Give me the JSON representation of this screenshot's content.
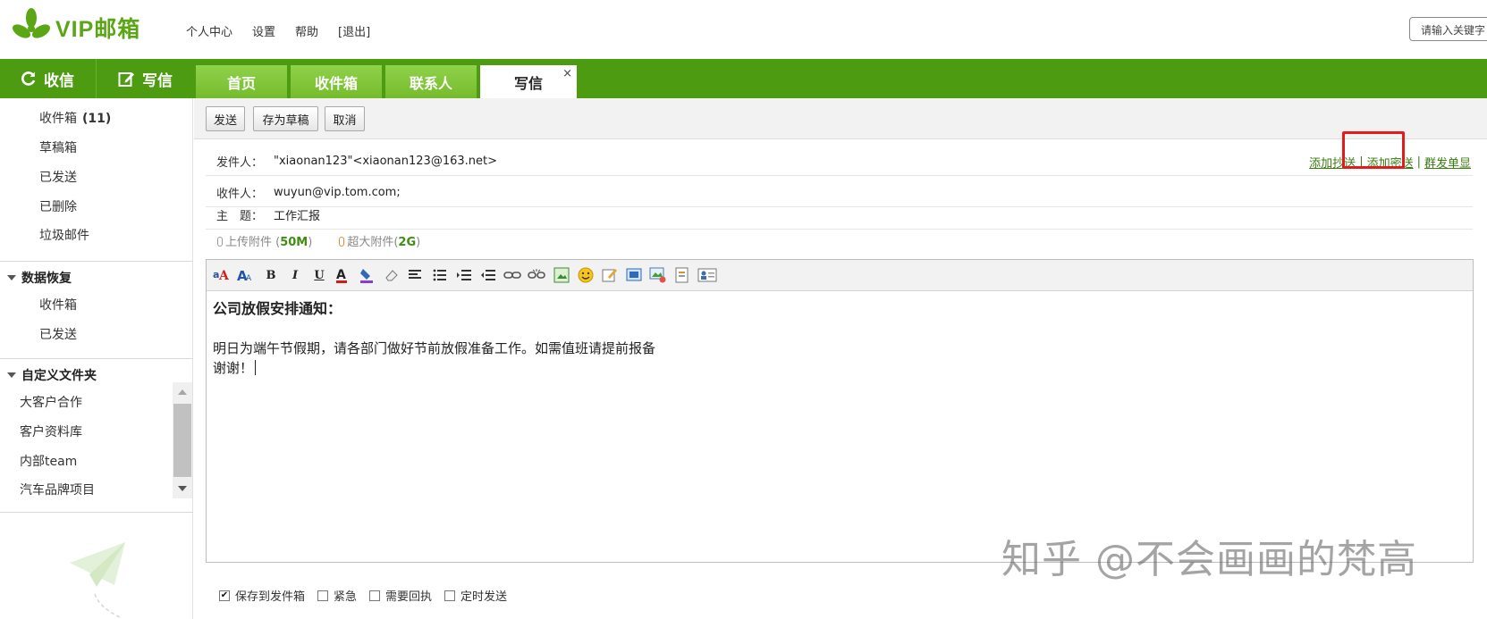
{
  "header": {
    "logo_text": "VIP邮箱",
    "links": [
      "个人中心",
      "设置",
      "帮助",
      "[退出]"
    ],
    "search_placeholder": "请输入关键字"
  },
  "nav": {
    "receive_label": "收信",
    "write_label": "写信",
    "tabs": [
      "首页",
      "收件箱",
      "联系人",
      "写信"
    ],
    "active_tab_close": "×"
  },
  "sidebar": {
    "folders": [
      {
        "label": "收件箱",
        "count": "(11)"
      },
      {
        "label": "草稿箱"
      },
      {
        "label": "已发送"
      },
      {
        "label": "已删除"
      },
      {
        "label": "垃圾邮件"
      }
    ],
    "recovery_title": "数据恢复",
    "recovery_items": [
      "收件箱",
      "已发送"
    ],
    "custom_title": "自定义文件夹",
    "custom_items": [
      "大客户合作",
      "客户资料库",
      "内部team",
      "汽车品牌项目"
    ]
  },
  "toolbar": {
    "send_label": "发送",
    "draft_label": "存为草稿",
    "cancel_label": "取消"
  },
  "compose": {
    "from_label": "发件人：",
    "from_value": "\"xiaonan123\"<xiaonan123@163.net>",
    "to_label": "收件人：",
    "to_value": "wuyun@vip.tom.com;",
    "subject_label": "主　题：",
    "subject_value": "工作汇报",
    "add_cc": "添加抄送",
    "add_bcc": "添加密送",
    "group_single": "群发单显",
    "link_sep": "|",
    "attach_label": "上传附件 (",
    "attach_size": "50M",
    "attach_close": ")",
    "big_attach_label": "超大附件(",
    "big_attach_size": "2G",
    "big_attach_close": ")"
  },
  "body": {
    "title": "公司放假安排通知：",
    "line1": "明日为端午节假期，请各部门做好节前放假准备工作。如需值班请提前报备",
    "line2": "谢谢！"
  },
  "options": [
    {
      "label": "保存到发件箱",
      "checked": true
    },
    {
      "label": "紧急",
      "checked": false
    },
    {
      "label": "需要回执",
      "checked": false
    },
    {
      "label": "定时发送",
      "checked": false
    }
  ],
  "watermark": "知乎 @不会画画的梵高",
  "colors": {
    "brand_green": "#4c9b10",
    "tab_green": "#7cc033",
    "link_green": "#3a7d11",
    "highlight_red": "#e31b1b"
  }
}
